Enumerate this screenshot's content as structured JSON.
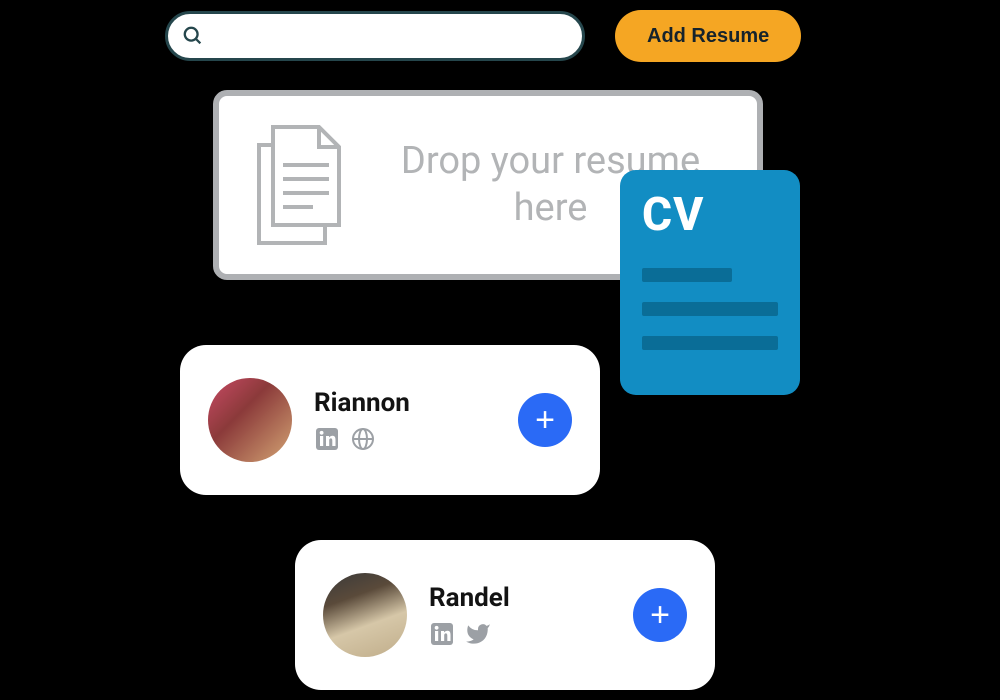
{
  "search": {
    "placeholder": ""
  },
  "buttons": {
    "add_resume": "Add Resume"
  },
  "drop_zone": {
    "text": "Drop your resume here"
  },
  "cv_card": {
    "label": "CV"
  },
  "candidates": [
    {
      "name": "Riannon",
      "socials": [
        "linkedin",
        "globe"
      ]
    },
    {
      "name": "Randel",
      "socials": [
        "linkedin",
        "twitter"
      ]
    }
  ],
  "colors": {
    "accent_orange": "#f5a623",
    "cv_blue": "#128dc3",
    "action_blue": "#2a6af6",
    "border_dark": "#25464c"
  }
}
